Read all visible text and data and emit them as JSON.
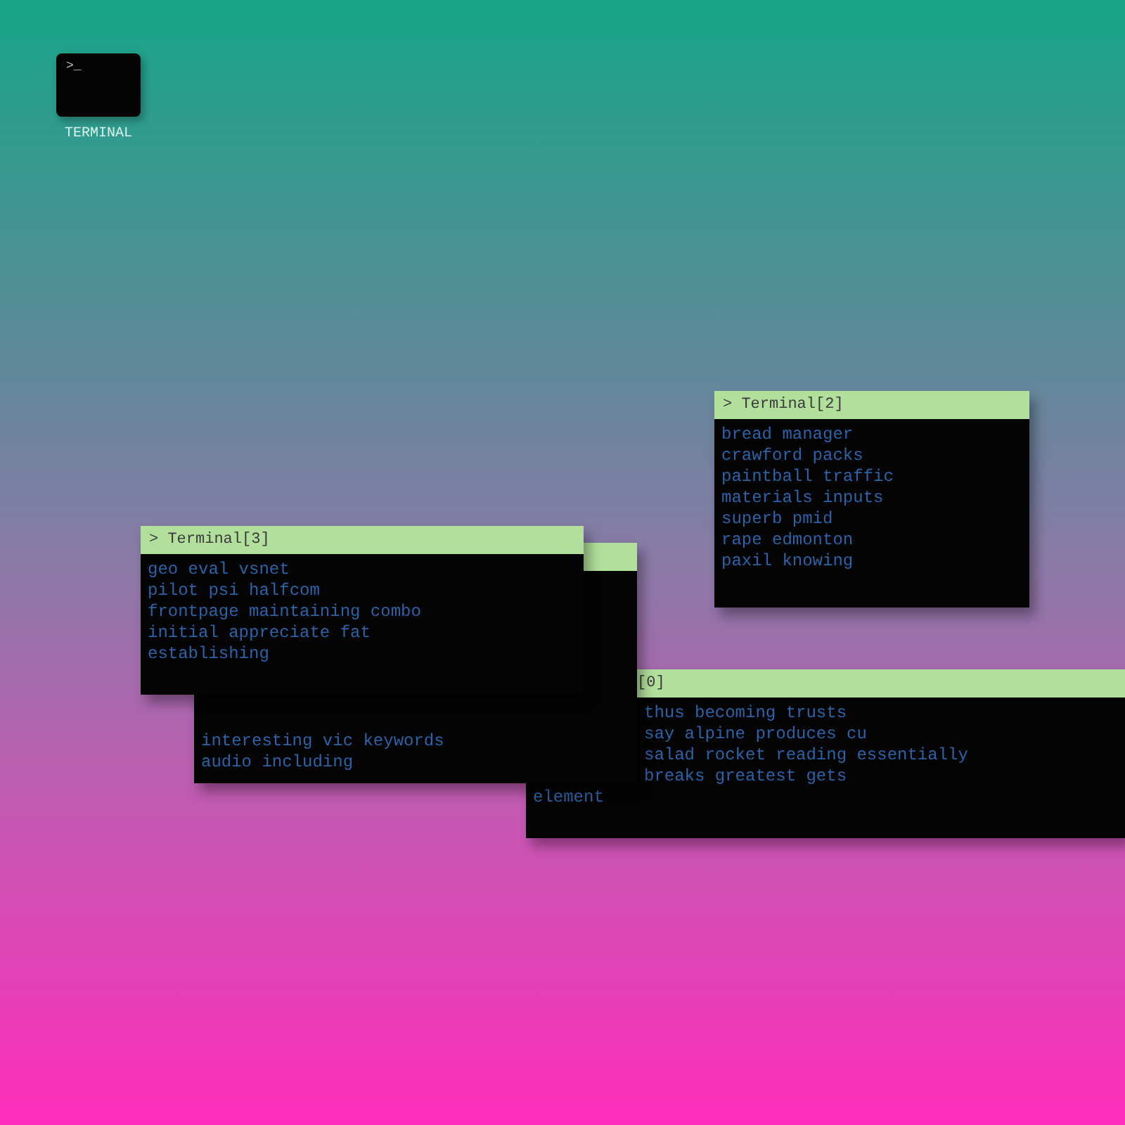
{
  "desktop_icon": {
    "glyph": ">_",
    "label": "TERMINAL"
  },
  "windows": [
    {
      "title": "> Terminal[2]",
      "title_clipped": false,
      "lines": [
        {
          "text": "bread manager",
          "clipped": false
        },
        {
          "text": "crawford packs",
          "clipped": false
        },
        {
          "text": "paintball traffic",
          "clipped": false
        },
        {
          "text": "materials inputs",
          "clipped": false
        },
        {
          "text": "superb pmid",
          "clipped": false
        },
        {
          "text": "rape edmonton",
          "clipped": false
        },
        {
          "text": "paxil knowing",
          "clipped": false
        }
      ]
    },
    {
      "title": "> Terminal[3]",
      "title_clipped": false,
      "lines": [
        {
          "text": "geo eval vsnet",
          "clipped": false
        },
        {
          "text": "pilot psi halfcom",
          "clipped": false
        },
        {
          "text": "frontpage maintaining combo",
          "clipped": false
        },
        {
          "text": "initial appreciate fat",
          "clipped": false
        },
        {
          "text": "establishing",
          "clipped": false
        }
      ]
    },
    {
      "title_clipped": true,
      "lines": [
        {
          "text": "interesting vic keywords",
          "clipped": false
        },
        {
          "text": "audio including",
          "clipped": false
        }
      ]
    },
    {
      "title": "[0]",
      "title_clipped": true,
      "lines": [
        {
          "text": "thus becoming trusts",
          "clipped": true
        },
        {
          "text": "say alpine produces cu",
          "clipped": true
        },
        {
          "text": "salad rocket reading essentially",
          "clipped": true
        },
        {
          "text": "breaks greatest gets",
          "clipped": true
        },
        {
          "text": "element",
          "clipped": false
        }
      ]
    }
  ]
}
